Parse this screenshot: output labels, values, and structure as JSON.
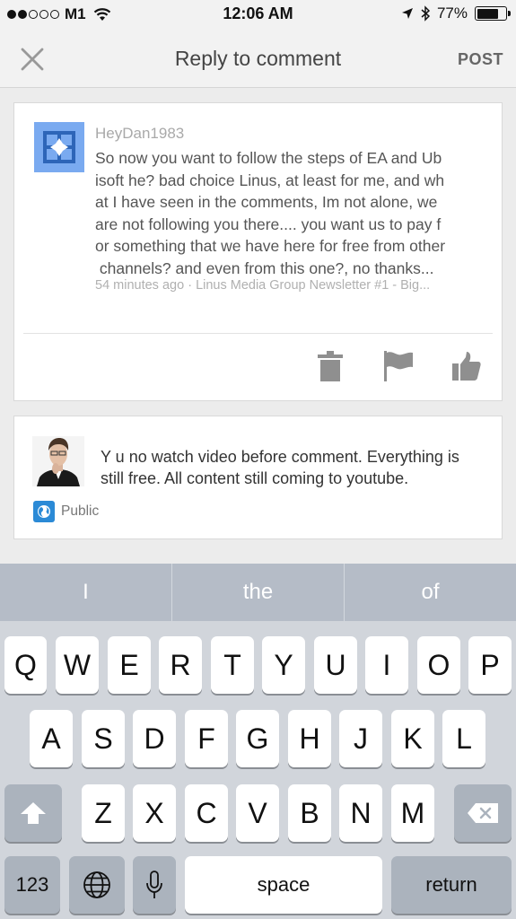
{
  "status_bar": {
    "carrier": "M1",
    "time": "12:06 AM",
    "battery": "77%",
    "battery_level": 0.77
  },
  "nav": {
    "title": "Reply to comment",
    "post_label": "POST"
  },
  "comment": {
    "author": "HeyDan1983",
    "lines": [
      "So now you want to follow the steps of EA and Ub",
      "isoft he? bad choice Linus, at least for me, and wh",
      "at I have seen in the comments, Im not alone, we",
      "are not following you there.... you want us to pay f",
      "or something that we have here for free from other",
      " channels? and even from this one?, no thanks..."
    ],
    "time_ago": "54 minutes ago",
    "separator": "·",
    "video": "Linus Media Group Newsletter #1 - Big..."
  },
  "reply": {
    "text": "Y u no watch video before comment. Everything is still free. All content still coming to youtube.",
    "visibility": "Public"
  },
  "keyboard": {
    "suggestions": [
      "I",
      "the",
      "of"
    ],
    "row1": [
      "Q",
      "W",
      "E",
      "R",
      "T",
      "Y",
      "U",
      "I",
      "O",
      "P"
    ],
    "row2": [
      "A",
      "S",
      "D",
      "F",
      "G",
      "H",
      "J",
      "K",
      "L"
    ],
    "row3": [
      "Z",
      "X",
      "C",
      "V",
      "B",
      "N",
      "M"
    ],
    "numbers_label": "123",
    "space_label": "space",
    "return_label": "return"
  },
  "colors": {
    "avatar_blue": "#7aaaf0",
    "globe_blue": "#2b8ad6",
    "keyboard_bg": "#d1d5db",
    "suggestion_bar": "#b5bcc7"
  }
}
